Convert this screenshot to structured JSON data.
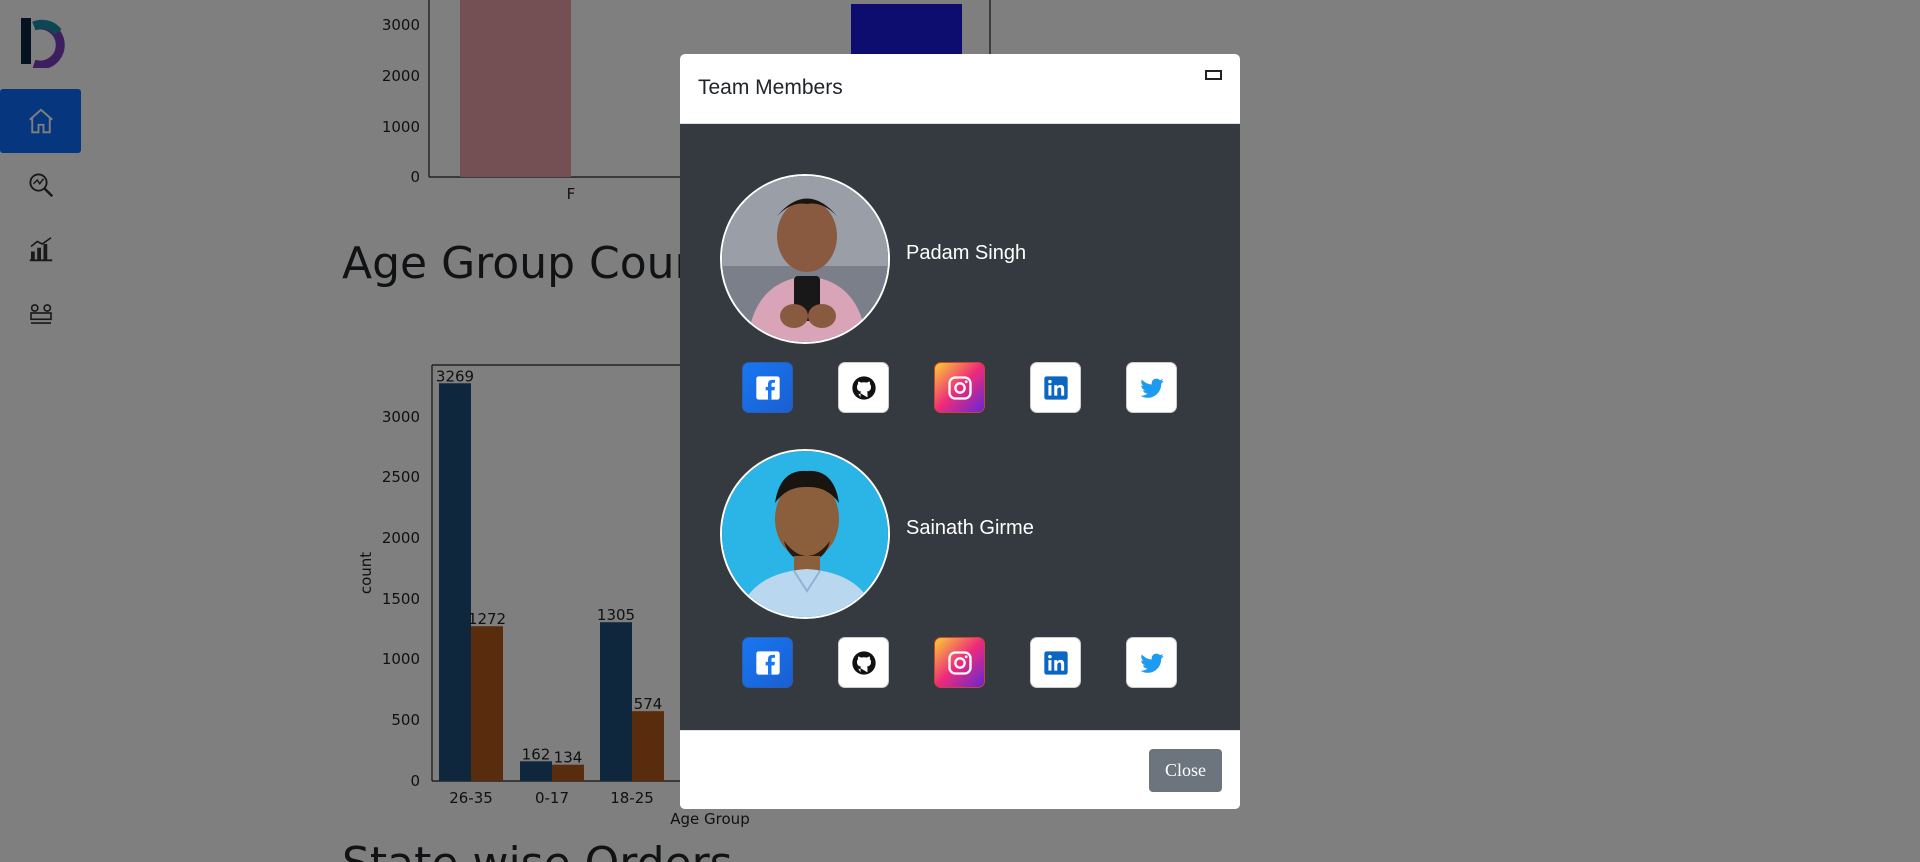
{
  "sidebar": {
    "items": [
      {
        "icon": "home-icon",
        "active": true
      },
      {
        "icon": "analysis-icon",
        "active": false
      },
      {
        "icon": "stats-icon",
        "active": false
      },
      {
        "icon": "team-icon",
        "active": false
      }
    ]
  },
  "page": {
    "section_title": "Age Group Count",
    "section_title_2": "State wise Orders"
  },
  "chart_data": [
    {
      "type": "bar",
      "categories": [
        "F"
      ],
      "values": [
        3500
      ],
      "yticks": [
        "0",
        "1000",
        "2000",
        "3000"
      ],
      "ylim": [
        0,
        3500
      ]
    },
    {
      "type": "bar",
      "xlabel": "Age Group",
      "ylabel": "count",
      "categories": [
        "26-35",
        "0-17",
        "18-25"
      ],
      "series": [
        {
          "values": [
            3269,
            162,
            1305
          ],
          "color": "#1f4e79"
        },
        {
          "values": [
            1272,
            134,
            574
          ],
          "color": "#b3591b"
        }
      ],
      "yticks": [
        "0",
        "500",
        "1000",
        "1500",
        "2000",
        "2500",
        "3000"
      ],
      "ylim": [
        0,
        3400
      ]
    }
  ],
  "modal": {
    "title": "Team Members",
    "members": [
      {
        "name": "Padam Singh"
      },
      {
        "name": "Sainath Girme"
      }
    ],
    "social_icons": [
      "facebook-icon",
      "github-icon",
      "instagram-icon",
      "linkedin-icon",
      "twitter-icon"
    ],
    "close_label": "Close"
  }
}
